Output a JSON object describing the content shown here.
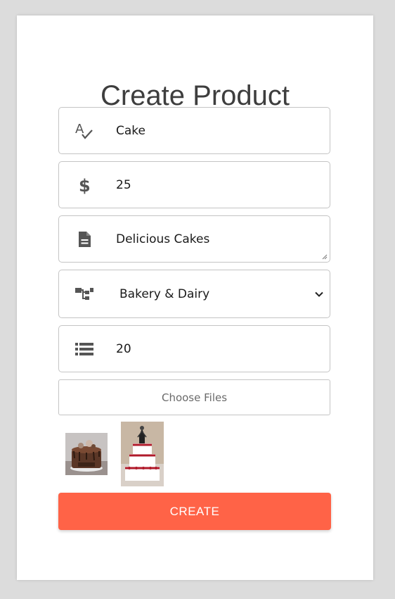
{
  "form": {
    "title": "Create Product",
    "name_value": "Cake",
    "price_value": "25",
    "description_value": "Delicious Cakes",
    "category_value": "Bakery & Dairy",
    "stock_value": "20",
    "files_label": "Choose Files",
    "submit_label": "CREATE"
  },
  "icons": {
    "name": "spellcheck-icon",
    "price": "dollar-icon",
    "description": "document-icon",
    "category": "hierarchy-icon",
    "stock": "list-icon",
    "dropdown": "chevron-down-icon"
  },
  "colors": {
    "accent": "#ff6347",
    "icon": "#555555",
    "background": "#dcdcdc"
  }
}
